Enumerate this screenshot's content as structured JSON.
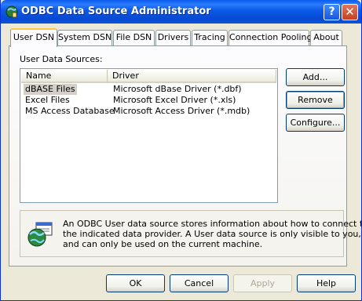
{
  "window": {
    "title": "ODBC Data Source Administrator",
    "help_button": "?",
    "close_button": "✕"
  },
  "tabs": [
    {
      "label": "User DSN",
      "active": true
    },
    {
      "label": "System DSN"
    },
    {
      "label": "File DSN"
    },
    {
      "label": "Drivers"
    },
    {
      "label": "Tracing"
    },
    {
      "label": "Connection Pooling"
    },
    {
      "label": "About"
    }
  ],
  "user_dsn": {
    "section_label": "User Data Sources:",
    "columns": [
      "Name",
      "Driver"
    ],
    "rows": [
      {
        "name": "dBASE Files",
        "driver": "Microsoft dBase Driver (*.dbf)",
        "selected": true
      },
      {
        "name": "Excel Files",
        "driver": "Microsoft Excel Driver (*.xls)"
      },
      {
        "name": "MS Access Database",
        "driver": "Microsoft Access Driver (*.mdb)"
      }
    ],
    "buttons": {
      "add": "Add...",
      "remove": "Remove",
      "configure": "Configure..."
    },
    "info_lines": [
      "An ODBC User data source stores information about how to connect to",
      "the indicated data provider.   A User data source is only visible to you,",
      "and can only be used on the current machine."
    ]
  },
  "footer": {
    "ok": "OK",
    "cancel": "Cancel",
    "apply": "Apply",
    "help": "Help"
  }
}
